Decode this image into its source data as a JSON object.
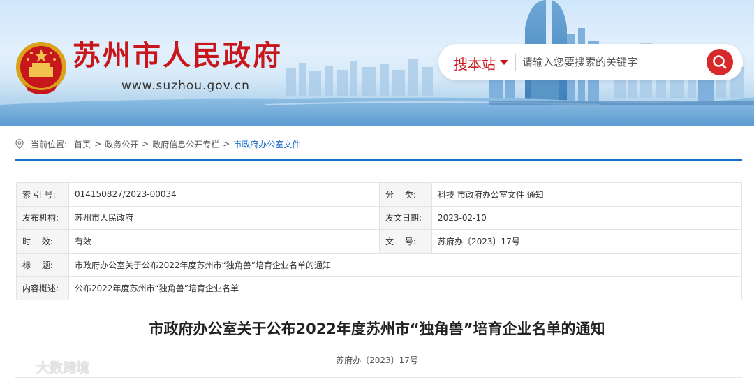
{
  "header": {
    "site_title": "苏州市人民政府",
    "site_url": "www.suzhou.gov.cn",
    "search": {
      "scope_label": "搜本站",
      "placeholder": "请输入您要搜索的关键字"
    }
  },
  "breadcrumb": {
    "prefix": "当前位置:",
    "items": [
      "首页",
      "政务公开",
      "政府信息公开专栏",
      "市政府办公室文件"
    ],
    "separator": ">"
  },
  "meta": {
    "rows": [
      {
        "k1": "索 引 号:",
        "v1": "014150827/2023-00034",
        "k2": "分　 类:",
        "v2": "科技 市政府办公室文件 通知"
      },
      {
        "k1": "发布机构:",
        "v1": "苏州市人民政府",
        "k2": "发文日期:",
        "v2": "2023-02-10"
      },
      {
        "k1": "时　 效:",
        "v1": "有效",
        "k2": "文　 号:",
        "v2": "苏府办〔2023〕17号"
      }
    ],
    "title_label": "标　 题:",
    "title_value": "市政府办公室关于公布2022年度苏州市“独角兽”培育企业名单的通知",
    "summary_label": "内容概述:",
    "summary_value": "公布2022年度苏州市“独角兽”培育企业名单"
  },
  "article": {
    "title": "市政府办公室关于公布2022年度苏州市“独角兽”培育企业名单的通知",
    "doc_number": "苏府办〔2023〕17号"
  },
  "watermark": {
    "text": "大数跨境"
  },
  "colors": {
    "brand_red": "#c8161d",
    "link_blue": "#1a6fc9",
    "search_button": "#d7282b",
    "table_key_bg": "#f5f5f5"
  },
  "icons": {
    "emblem": "national-emblem-icon",
    "search": "search-icon",
    "location": "location-pin-icon",
    "dropdown": "caret-down-icon"
  }
}
